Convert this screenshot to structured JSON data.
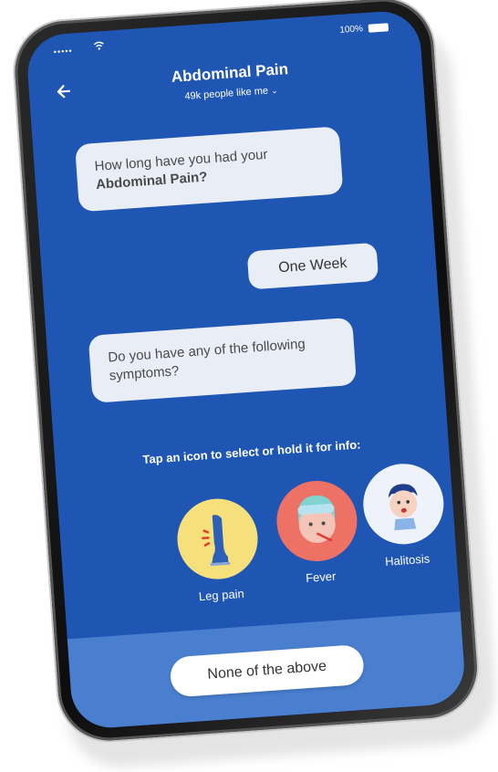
{
  "status_bar": {
    "signal": "•••••",
    "battery_percent": "100%"
  },
  "header": {
    "title": "Abdominal Pain",
    "subtitle": "49k people like me",
    "back_icon": "arrow-left-icon"
  },
  "chat": {
    "question1_prefix": "How long have you had your ",
    "question1_bold": "Abdominal Pain?",
    "answer1": "One Week",
    "question2": "Do you have any of the following symptoms?"
  },
  "instruction": "Tap an icon to select or hold it for info:",
  "symptoms": [
    {
      "label": "Leg pain",
      "icon": "leg-pain-icon",
      "color": "#f6e07b"
    },
    {
      "label": "Fever",
      "icon": "fever-face-icon",
      "color": "#ee7166"
    },
    {
      "label": "Halitosis",
      "icon": "halitosis-face-icon",
      "color": "#eef2fa"
    }
  ],
  "footer": {
    "none_button": "None of the above"
  },
  "colors": {
    "screen_bg": "#1f56b4",
    "footer_bg": "#4a7fd0",
    "bubble_bg": "#e9edf6"
  }
}
